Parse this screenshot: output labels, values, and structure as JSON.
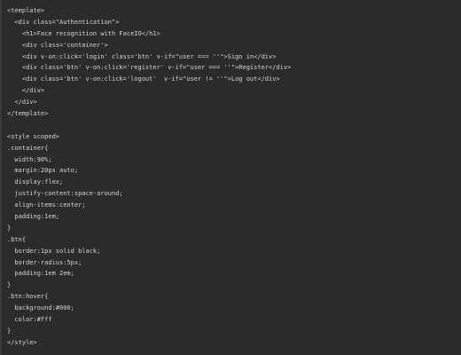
{
  "code_block": {
    "language": "vue",
    "background": "#2b2b2b",
    "text_color": "#d4d4d4",
    "lines": [
      "<template>",
      "  <div class=\"Authentication\">",
      "    <h1>Face recognition with FaceIO</h1>",
      "    <div class='container'>",
      "    <div v-on:click='login' class='btn' v-if=\"user === ''\">Sign in</div>",
      "    <div class='btn' v-on:click='register' v-if=\"user === ''\">Register</div>",
      "    <div class='btn' v-on:click='logout'  v-if=\"user != ''\">Log out</div>",
      "    </div>",
      "  </div>",
      "</template>",
      "",
      "<style scoped>",
      ".container{",
      "  width:90%;",
      "  margin:20px auto;",
      "  display:flex;",
      "  justify-content:space-around;",
      "  align-items:center;",
      "  padding:1em;",
      "}",
      ".btn{",
      "  border:1px solid black;",
      "  border-radius:5px;",
      "  padding:1em 2em;",
      "}",
      ".btn:hover{",
      "  background:#000;",
      "  color:#fff",
      "}",
      "</style>"
    ]
  }
}
